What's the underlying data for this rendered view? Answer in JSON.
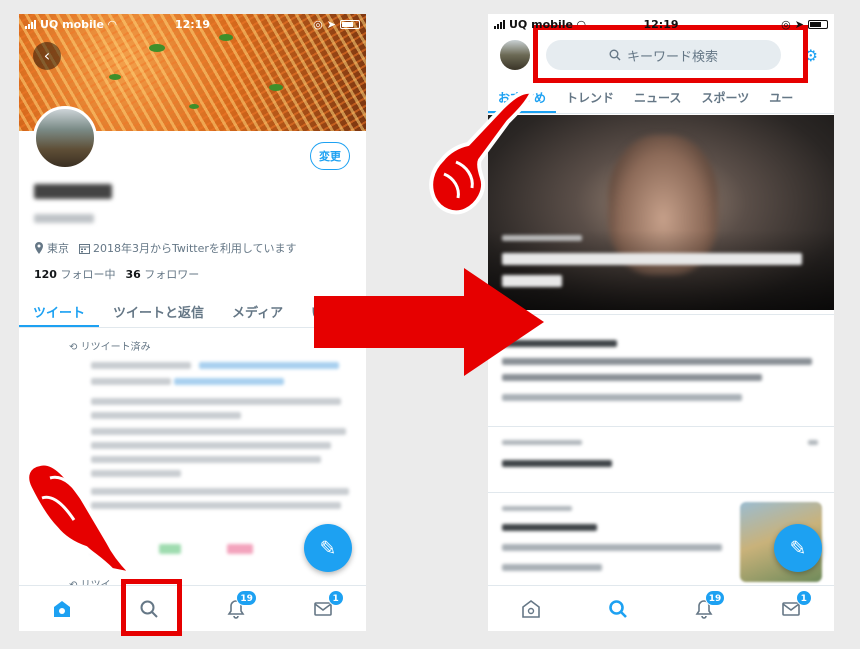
{
  "left_screen": {
    "status": {
      "carrier": "UQ mobile",
      "time": "12:19"
    },
    "profile": {
      "edit_label": "変更",
      "location": "東京",
      "joined": "2018年3月からTwitterを利用しています",
      "following_count": "120",
      "following_label": "フォロー中",
      "followers_count": "36",
      "followers_label": "フォロワー"
    },
    "tabs": [
      "ツイート",
      "ツイートと返信",
      "メディア",
      "い"
    ],
    "retweet_note": "リツイート済み",
    "retweet_note_bottom": "リツイ",
    "nav": {
      "notifications_badge": "19",
      "messages_badge": "1"
    }
  },
  "right_screen": {
    "status": {
      "carrier": "UQ mobile",
      "time": "12:19"
    },
    "search_placeholder": "キーワード検索",
    "tabs": [
      "おすすめ",
      "トレンド",
      "ニュース",
      "スポーツ",
      "ユー"
    ],
    "nav": {
      "notifications_badge": "19",
      "messages_badge": "1"
    }
  },
  "colors": {
    "twitter_blue": "#1da1f2",
    "annotation_red": "#e60000"
  },
  "icons": [
    "home-icon",
    "search-icon",
    "bell-icon",
    "mail-icon",
    "gear-icon",
    "compose-icon",
    "location-icon",
    "calendar-icon",
    "retweet-icon",
    "back-icon"
  ]
}
